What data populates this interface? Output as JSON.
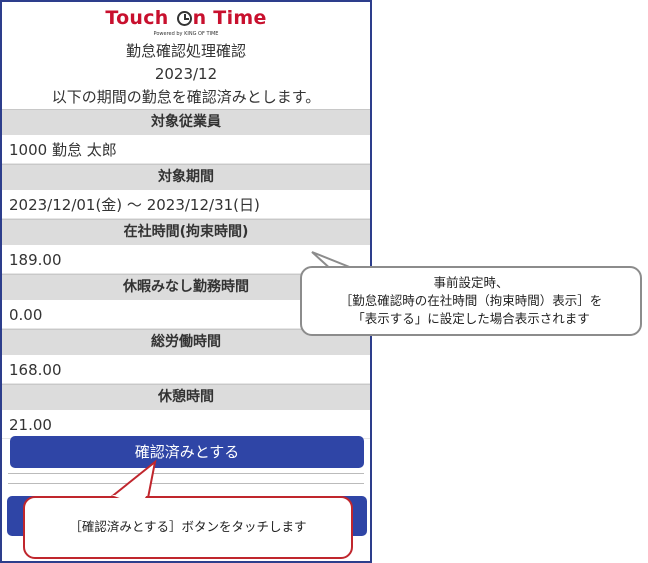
{
  "logo": {
    "part1": "Touch ",
    "part2": "n Time",
    "sub": "Powered by KING OF TIME"
  },
  "header": {
    "title": "勤怠確認処理確認",
    "month": "2023/12",
    "message": "以下の期間の勤怠を確認済みとします。"
  },
  "sections": [
    {
      "label": "対象従業員",
      "value": "1000 勤怠 太郎"
    },
    {
      "label": "対象期間",
      "value": "2023/12/01(金) ～ 2023/12/31(日)"
    },
    {
      "label": "在社時間(拘束時間)",
      "value": "189.00"
    },
    {
      "label": "休暇みなし勤務時間",
      "value": "0.00"
    },
    {
      "label": "総労働時間",
      "value": "168.00"
    },
    {
      "label": "休憩時間",
      "value": "21.00"
    }
  ],
  "confirm_button": "確認済みとする",
  "callouts": {
    "grey": {
      "line1": "事前設定時、",
      "line2": "［勤怠確認時の在社時間（拘束時間）表示］を",
      "line3": "「表示する」に設定した場合表示されます"
    },
    "red": "［確認済みとする］ボタンをタッチします"
  },
  "colors": {
    "brand_red": "#c8102e",
    "button_blue": "#2f45a6",
    "callout_red": "#c0262d",
    "callout_grey": "#8c8c8c"
  }
}
